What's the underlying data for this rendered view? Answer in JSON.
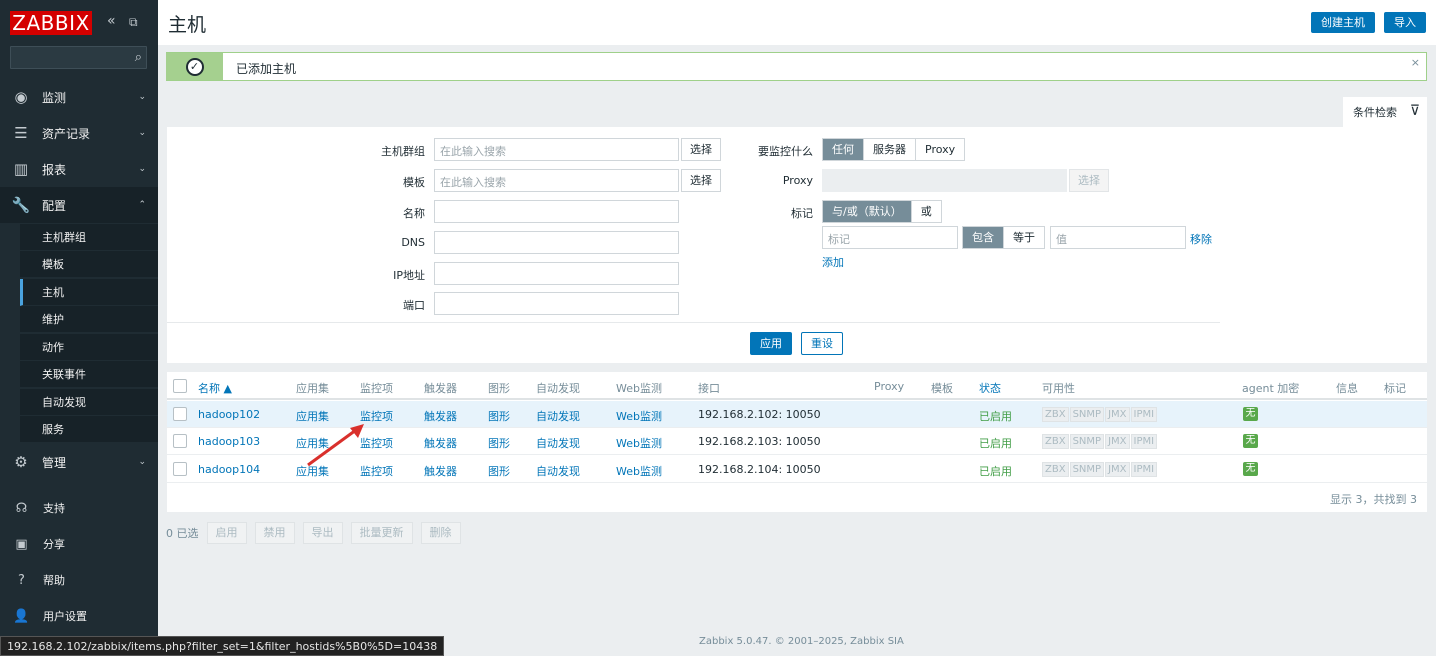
{
  "sidebar": {
    "logo": "ZABBIX",
    "collapse_icon": "«",
    "kiosk_icon": "⧉",
    "menu": [
      {
        "label": "监测",
        "icon": "eye-icon"
      },
      {
        "label": "资产记录",
        "icon": "list-icon"
      },
      {
        "label": "报表",
        "icon": "bar-chart-icon"
      },
      {
        "label": "配置",
        "icon": "wrench-icon"
      },
      {
        "label": "管理",
        "icon": "cog-icon"
      }
    ],
    "sub": [
      "主机群组",
      "模板",
      "主机",
      "维护",
      "动作",
      "关联事件",
      "自动发现",
      "服务"
    ],
    "bottom": [
      "支持",
      "分享",
      "帮助",
      "用户设置"
    ]
  },
  "header": {
    "title": "主机",
    "create_host": "创建主机",
    "import": "导入"
  },
  "message": {
    "text": "已添加主机"
  },
  "filter": {
    "tab": "条件检索",
    "host_groups_label": "主机群组",
    "host_groups_placeholder": "在此输入搜索",
    "templates_label": "模板",
    "templates_placeholder": "在此输入搜索",
    "select": "选择",
    "name_label": "名称",
    "dns_label": "DNS",
    "ip_label": "IP地址",
    "port_label": "端口",
    "monitored_by_label": "要监控什么",
    "monitored_by": [
      "任何",
      "服务器",
      "Proxy"
    ],
    "proxy_label": "Proxy",
    "tags_label": "标记",
    "tags_mode": [
      "与/或（默认）",
      "或"
    ],
    "tag_placeholder": "标记",
    "tag_ops": [
      "包含",
      "等于"
    ],
    "value_placeholder": "值",
    "remove": "移除",
    "add": "添加",
    "apply": "应用",
    "reset": "重设"
  },
  "table": {
    "headers": [
      "名称 ▲",
      "应用集",
      "监控项",
      "触发器",
      "图形",
      "自动发现",
      "Web监测",
      "接口",
      "Proxy",
      "模板",
      "状态",
      "可用性",
      "agent 加密",
      "信息",
      "标记"
    ],
    "rows": [
      {
        "name": "hadoop102",
        "apps": "应用集",
        "items": "监控项",
        "triggers": "触发器",
        "graphs": "图形",
        "discovery": "自动发现",
        "web": "Web监测",
        "interface": "192.168.2.102: 10050",
        "status": "已启用",
        "enc": "无"
      },
      {
        "name": "hadoop103",
        "apps": "应用集",
        "items": "监控项",
        "triggers": "触发器",
        "graphs": "图形",
        "discovery": "自动发现",
        "web": "Web监测",
        "interface": "192.168.2.103: 10050",
        "status": "已启用",
        "enc": "无"
      },
      {
        "name": "hadoop104",
        "apps": "应用集",
        "items": "监控项",
        "triggers": "触发器",
        "graphs": "图形",
        "discovery": "自动发现",
        "web": "Web监测",
        "interface": "192.168.2.104: 10050",
        "status": "已启用",
        "enc": "无"
      }
    ],
    "availability": [
      "ZBX",
      "SNMP",
      "JMX",
      "IPMI"
    ],
    "summary": "显示 3，共找到 3"
  },
  "actions": {
    "selected": "0 已选",
    "buttons": [
      "启用",
      "禁用",
      "导出",
      "批量更新",
      "删除"
    ]
  },
  "statusbar": "192.168.2.102/zabbix/items.php?filter_set=1&filter_hostids%5B0%5D=10438",
  "copyright": "Zabbix 5.0.47. © 2001–2025, Zabbix SIA",
  "colors": {
    "sidebar": "#1f2c33",
    "accent": "#0275b8",
    "ok": "#59a84b",
    "logo": "#d40000"
  }
}
